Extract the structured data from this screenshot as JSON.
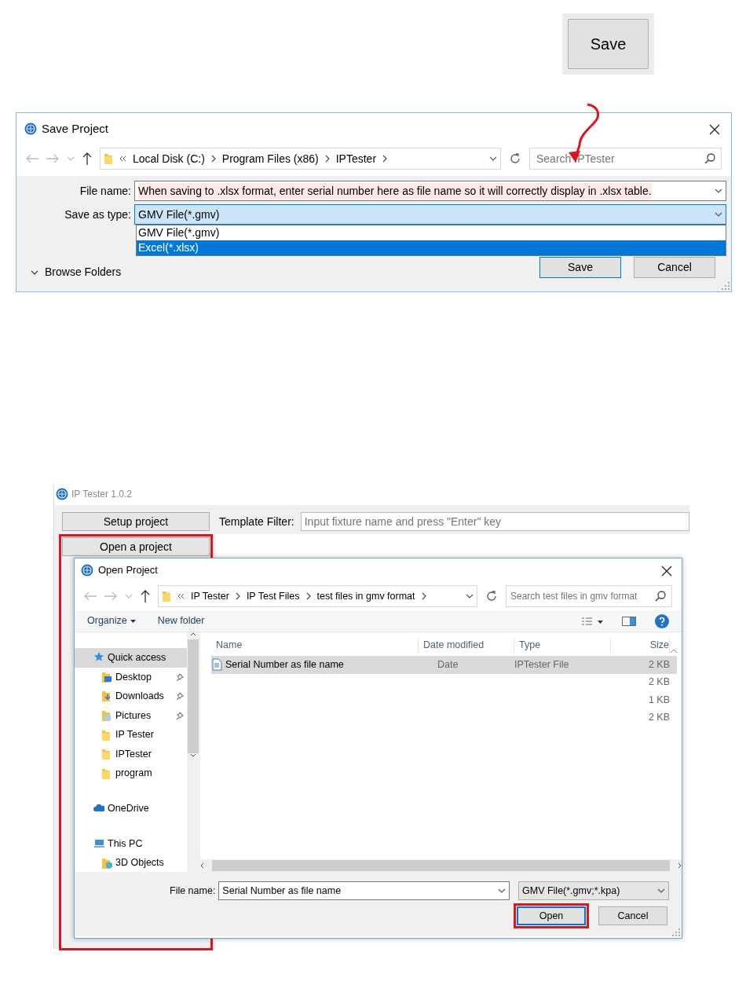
{
  "save_button": "Save",
  "save_dialog": {
    "title": "Save Project",
    "breadcrumb": [
      "Local Disk (C:)",
      "Program Files (x86)",
      "IPTester"
    ],
    "search_placeholder": "Search IPTester",
    "file_name_label": "File name:",
    "file_name_value": "When saving to .xlsx format, enter serial number here as file name so it will correctly display in .xlsx table.",
    "save_type_label": "Save as type:",
    "save_type_value": "GMV File(*.gmv)",
    "type_options": [
      {
        "label": "GMV File(*.gmv)",
        "selected": false
      },
      {
        "label": "Excel(*.xlsx)",
        "selected": true
      }
    ],
    "browse_folders": "Browse Folders",
    "buttons": [
      {
        "label": "Save",
        "kind": "default"
      },
      {
        "label": "Cancel",
        "kind": "normal"
      }
    ]
  },
  "app": {
    "title": "IP Tester 1.0.2",
    "buttons": [
      {
        "label": "Setup project",
        "highlighted": false
      },
      {
        "label": "Open a project",
        "highlighted": true
      }
    ],
    "filter_label": "Template Filter:",
    "filter_placeholder": "Input fixture name and press \"Enter\" key"
  },
  "open_dialog": {
    "title": "Open Project",
    "breadcrumb": [
      "IP Tester",
      "IP Test Files",
      "test files in gmv format"
    ],
    "search_placeholder": "Search test files in gmv format",
    "toolbar": [
      {
        "label": "Organize",
        "kind": "menu"
      },
      {
        "label": "New folder",
        "kind": "plain"
      }
    ],
    "sidebar": [
      {
        "label": "Quick access",
        "kind": "star",
        "selected": true,
        "pinned": false,
        "children": [
          {
            "label": "Desktop",
            "kind": "desktop",
            "selected": false,
            "pinned": true
          },
          {
            "label": "Downloads",
            "kind": "downloads",
            "selected": false,
            "pinned": true
          },
          {
            "label": "Pictures",
            "kind": "pictures",
            "selected": false,
            "pinned": true
          },
          {
            "label": "IP Tester",
            "kind": "folder",
            "selected": false,
            "pinned": false
          },
          {
            "label": "IPTester",
            "kind": "folder",
            "selected": false,
            "pinned": false
          },
          {
            "label": "program",
            "kind": "folder",
            "selected": false,
            "pinned": false
          }
        ]
      },
      {
        "label": "OneDrive",
        "kind": "cloud",
        "selected": false,
        "pinned": false
      },
      {
        "label": "This PC",
        "kind": "pc",
        "selected": false,
        "pinned": false,
        "children": [
          {
            "label": "3D Objects",
            "kind": "objects",
            "selected": false,
            "pinned": false
          }
        ]
      }
    ],
    "columns": [
      "Name",
      "Date modified",
      "Type",
      "Size"
    ],
    "rows": [
      {
        "name": "Serial Number as file name",
        "date": "Date",
        "type": "IPTester File",
        "size": "2 KB",
        "selected": true
      },
      {
        "size": "2 KB",
        "selected": false
      },
      {
        "size": "1 KB",
        "selected": false
      },
      {
        "size": "2 KB",
        "selected": false
      }
    ],
    "file_name_label": "File name:",
    "file_name_value": "Serial Number as file name",
    "filter_value": "GMV File(*.gmv;*.kpa)",
    "buttons": [
      {
        "label": "Open",
        "kind": "default",
        "highlighted": true
      },
      {
        "label": "Cancel",
        "kind": "normal",
        "highlighted": false
      }
    ]
  }
}
